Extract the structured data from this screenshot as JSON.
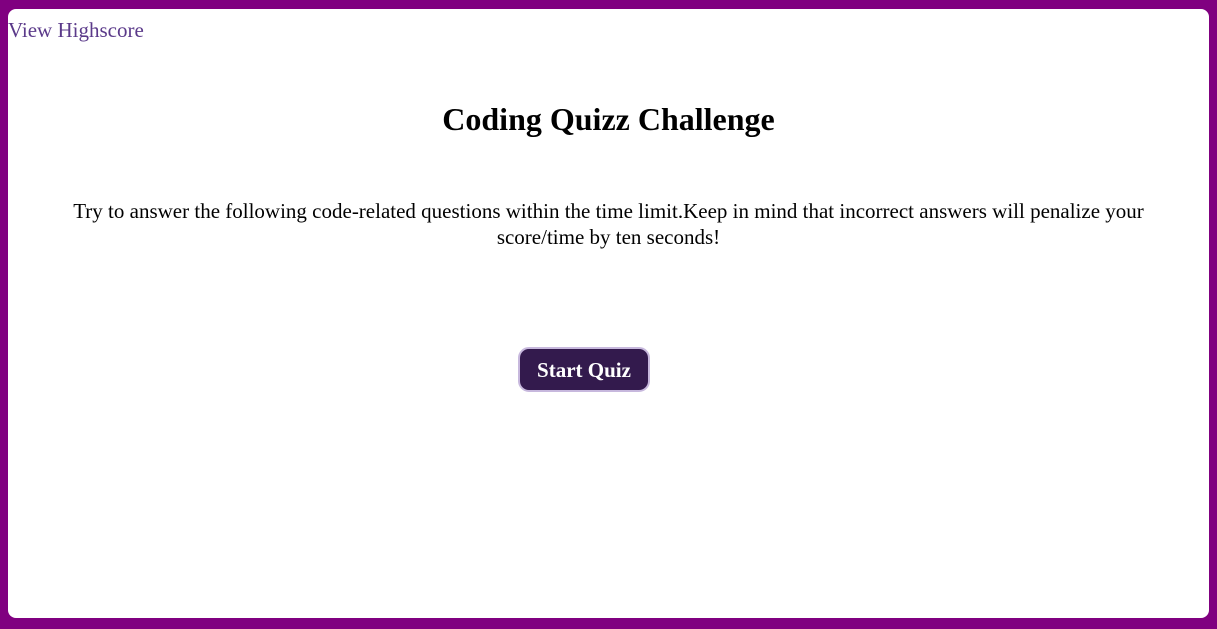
{
  "header": {
    "highscore_link": "View Highscore"
  },
  "main": {
    "title": "Coding Quizz Challenge",
    "instructions": "Try to answer the following code-related questions within the time limit.Keep in mind that incorrect answers will penalize your score/time by ten seconds!",
    "start_button": "Start Quiz"
  },
  "colors": {
    "border": "#800080",
    "link": "#5b3a8a",
    "button_bg": "#331a4d",
    "button_text": "#ffffff"
  }
}
